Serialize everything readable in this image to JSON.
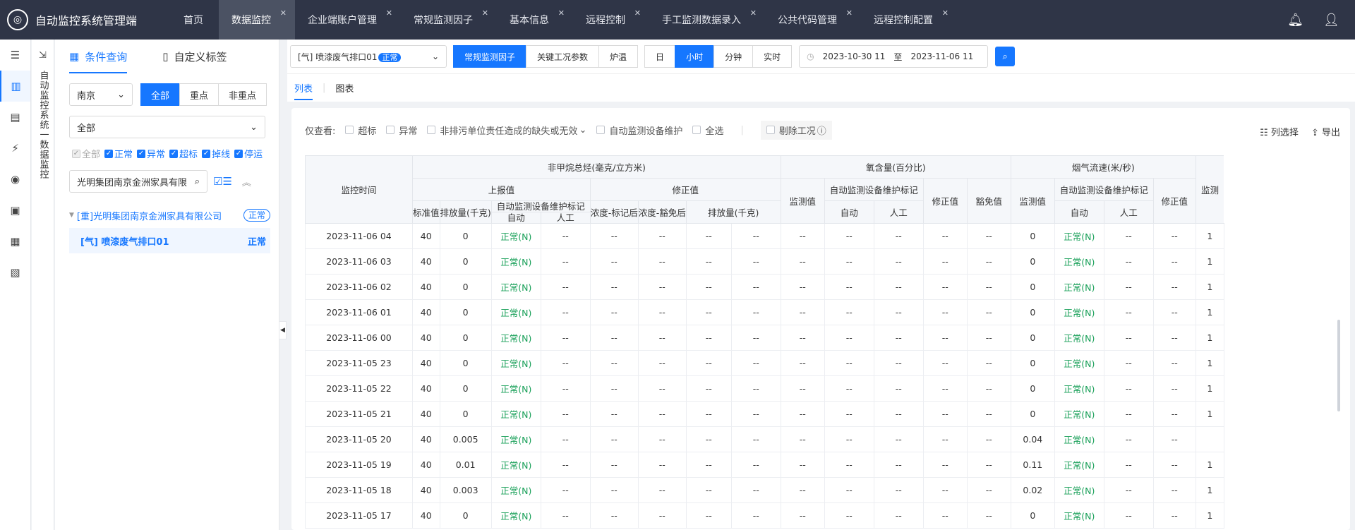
{
  "app": {
    "title": "自动监控系统管理端",
    "tabs": [
      {
        "label": "首页"
      },
      {
        "label": "数据监控"
      },
      {
        "label": "企业端账户管理"
      },
      {
        "label": "常规监测因子"
      },
      {
        "label": "基本信息"
      },
      {
        "label": "远程控制"
      },
      {
        "label": "手工监测数据录入"
      },
      {
        "label": "公共代码管理"
      },
      {
        "label": "远程控制配置"
      }
    ]
  },
  "vertical_label": "自动监控系统一数据监控",
  "left": {
    "tab_query": "条件查询",
    "tab_tag": "自定义标签",
    "city": "南京",
    "scope": [
      "全部",
      "重点",
      "非重点"
    ],
    "filter_all": "全部",
    "statuses": [
      "全部",
      "正常",
      "异常",
      "超标",
      "掉线",
      "停运"
    ],
    "search_value": "光明集团南京金洲家具有限",
    "tree": {
      "company": "[重]光明集团南京金洲家具有限公司",
      "company_badge": "正常",
      "outlet": "[气] 喷漆废气排口01",
      "outlet_status": "正常"
    }
  },
  "toolbar": {
    "outlet": "[气] 喷漆废气排口01",
    "outlet_tag": "正常",
    "categories": [
      "常规监测因子",
      "关键工况参数",
      "炉温"
    ],
    "periods": [
      "日",
      "小时",
      "分钟",
      "实时"
    ],
    "date_from": "2023-10-30 11",
    "date_sep": "至",
    "date_to": "2023-11-06 11"
  },
  "subtabs": [
    "列表",
    "图表"
  ],
  "filters": {
    "label": "仅查看:",
    "items": [
      "超标",
      "异常",
      "非排污单位责任造成的缺失或无效",
      "自动监测设备维护",
      "全选"
    ],
    "remove": "剔除工况",
    "col_select": "列选择",
    "export": "导出"
  },
  "table": {
    "time_header": "监控时间",
    "groups": [
      {
        "name": "非甲烷总烃(毫克/立方米)"
      },
      {
        "name": "氧含量(百分比)"
      },
      {
        "name": "烟气流速(米/秒)"
      }
    ],
    "sub": {
      "reported": "上报值",
      "corrected": "修正值",
      "maint": "自动监测设备维护标记",
      "monitor": "监测值",
      "exempt": "豁免值"
    },
    "leaf": {
      "std": "标准值",
      "emit": "排放量(千克)",
      "auto": "自动",
      "manual": "人工",
      "conc_marked": "浓度-标记后",
      "conc_exempt": "浓度-豁免后",
      "emit2": "排放量(千克)"
    },
    "rows": [
      {
        "time": "2023-11-06 04",
        "std": "40",
        "emit": "0",
        "mark": "正常(N)",
        "flow": "0",
        "flow_mark": "正常(N)",
        "last": "1"
      },
      {
        "time": "2023-11-06 03",
        "std": "40",
        "emit": "0",
        "mark": "正常(N)",
        "flow": "0",
        "flow_mark": "正常(N)",
        "last": "1"
      },
      {
        "time": "2023-11-06 02",
        "std": "40",
        "emit": "0",
        "mark": "正常(N)",
        "flow": "0",
        "flow_mark": "正常(N)",
        "last": "1"
      },
      {
        "time": "2023-11-06 01",
        "std": "40",
        "emit": "0",
        "mark": "正常(N)",
        "flow": "0",
        "flow_mark": "正常(N)",
        "last": "1"
      },
      {
        "time": "2023-11-06 00",
        "std": "40",
        "emit": "0",
        "mark": "正常(N)",
        "flow": "0",
        "flow_mark": "正常(N)",
        "last": "1"
      },
      {
        "time": "2023-11-05 23",
        "std": "40",
        "emit": "0",
        "mark": "正常(N)",
        "flow": "0",
        "flow_mark": "正常(N)",
        "last": "1"
      },
      {
        "time": "2023-11-05 22",
        "std": "40",
        "emit": "0",
        "mark": "正常(N)",
        "flow": "0",
        "flow_mark": "正常(N)",
        "last": "1"
      },
      {
        "time": "2023-11-05 21",
        "std": "40",
        "emit": "0",
        "mark": "正常(N)",
        "flow": "0",
        "flow_mark": "正常(N)",
        "last": "1"
      },
      {
        "time": "2023-11-05 20",
        "std": "40",
        "emit": "0.005",
        "mark": "正常(N)",
        "flow": "0.04",
        "flow_mark": "正常(N)",
        "last": ""
      },
      {
        "time": "2023-11-05 19",
        "std": "40",
        "emit": "0.01",
        "mark": "正常(N)",
        "flow": "0.11",
        "flow_mark": "正常(N)",
        "last": "1"
      },
      {
        "time": "2023-11-05 18",
        "std": "40",
        "emit": "0.003",
        "mark": "正常(N)",
        "flow": "0.02",
        "flow_mark": "正常(N)",
        "last": "1"
      },
      {
        "time": "2023-11-05 17",
        "std": "40",
        "emit": "0",
        "mark": "正常(N)",
        "flow": "0",
        "flow_mark": "正常(N)",
        "last": "1"
      }
    ],
    "dash": "--"
  }
}
